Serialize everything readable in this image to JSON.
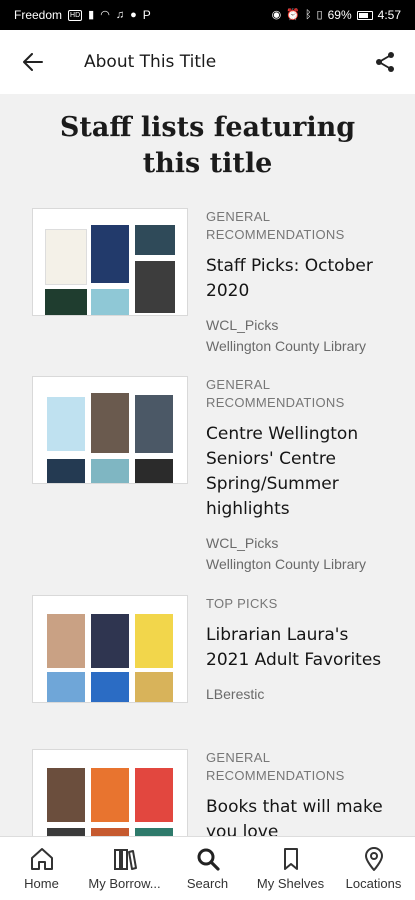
{
  "status_bar": {
    "carrier": "Freedom",
    "carrier_badge": "HD",
    "extra_letter": "P",
    "battery": "69%",
    "time": "4:57"
  },
  "app_bar": {
    "title": "About This Title"
  },
  "heading": "Staff lists featuring this title",
  "lists": [
    {
      "category": "General Recommendations",
      "title": "Staff Picks: October 2020",
      "meta": [
        "WCL_Picks",
        "Wellington County Library"
      ]
    },
    {
      "category": "General Recommendations",
      "title": "Centre Wellington Seniors' Centre Spring/Summer highlights",
      "meta": [
        "WCL_Picks",
        "Wellington County Library"
      ]
    },
    {
      "category": "Top Picks",
      "title": "Librarian Laura's 2021 Adult Favorites",
      "meta": [
        "LBerestic"
      ]
    },
    {
      "category": "General Recommendations",
      "title": "Books that will make you love",
      "meta": []
    }
  ],
  "bottom_nav": [
    {
      "label": "Home",
      "icon": "home-icon"
    },
    {
      "label": "My Borrow...",
      "icon": "books-icon"
    },
    {
      "label": "Search",
      "icon": "search-icon"
    },
    {
      "label": "My Shelves",
      "icon": "bookmark-icon"
    },
    {
      "label": "Locations",
      "icon": "location-pin-icon"
    }
  ],
  "colors": {
    "page_background": "#f1f1f1",
    "card_background": "#ffffff",
    "text_primary": "#151515",
    "text_secondary": "#6a6a6a",
    "status_bar": "#000000"
  }
}
